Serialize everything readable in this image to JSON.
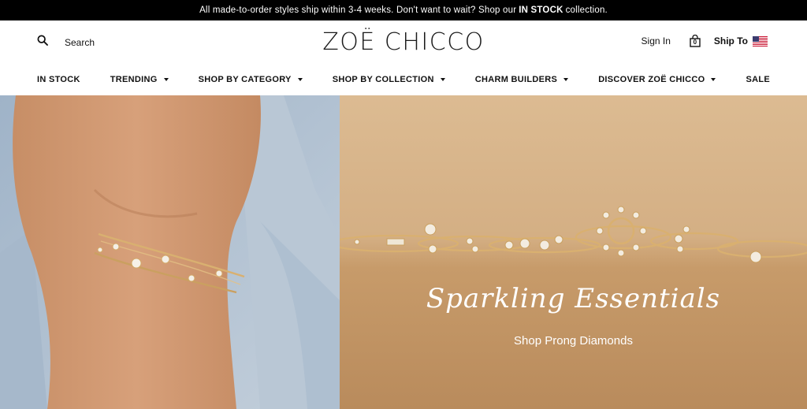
{
  "announcement": {
    "text_before": "All made-to-order styles ship within 3-4 weeks. Don't want to wait? Shop our",
    "link": "IN STOCK",
    "text_after": "collection."
  },
  "header": {
    "search_label": "Search",
    "logo": "ZOË CHICCO",
    "signin_label": "Sign In",
    "cart_count": "0",
    "ship_to_label": "Ship To",
    "ship_to_flag": "us-flag-icon"
  },
  "nav": {
    "items": [
      {
        "label": "IN STOCK",
        "dropdown": false
      },
      {
        "label": "TRENDING",
        "dropdown": true
      },
      {
        "label": "SHOP BY CATEGORY",
        "dropdown": true
      },
      {
        "label": "SHOP BY COLLECTION",
        "dropdown": true
      },
      {
        "label": "CHARM BUILDERS",
        "dropdown": true
      },
      {
        "label": "DISCOVER ZOË CHICCO",
        "dropdown": true
      },
      {
        "label": "SALE",
        "dropdown": false
      }
    ]
  },
  "hero": {
    "title": "Sparkling Essentials",
    "cta": "Shop Prong Diamonds"
  },
  "colors": {
    "announce_bg": "#000000",
    "gold": "#d9b070",
    "background_right": "#d5b389"
  }
}
